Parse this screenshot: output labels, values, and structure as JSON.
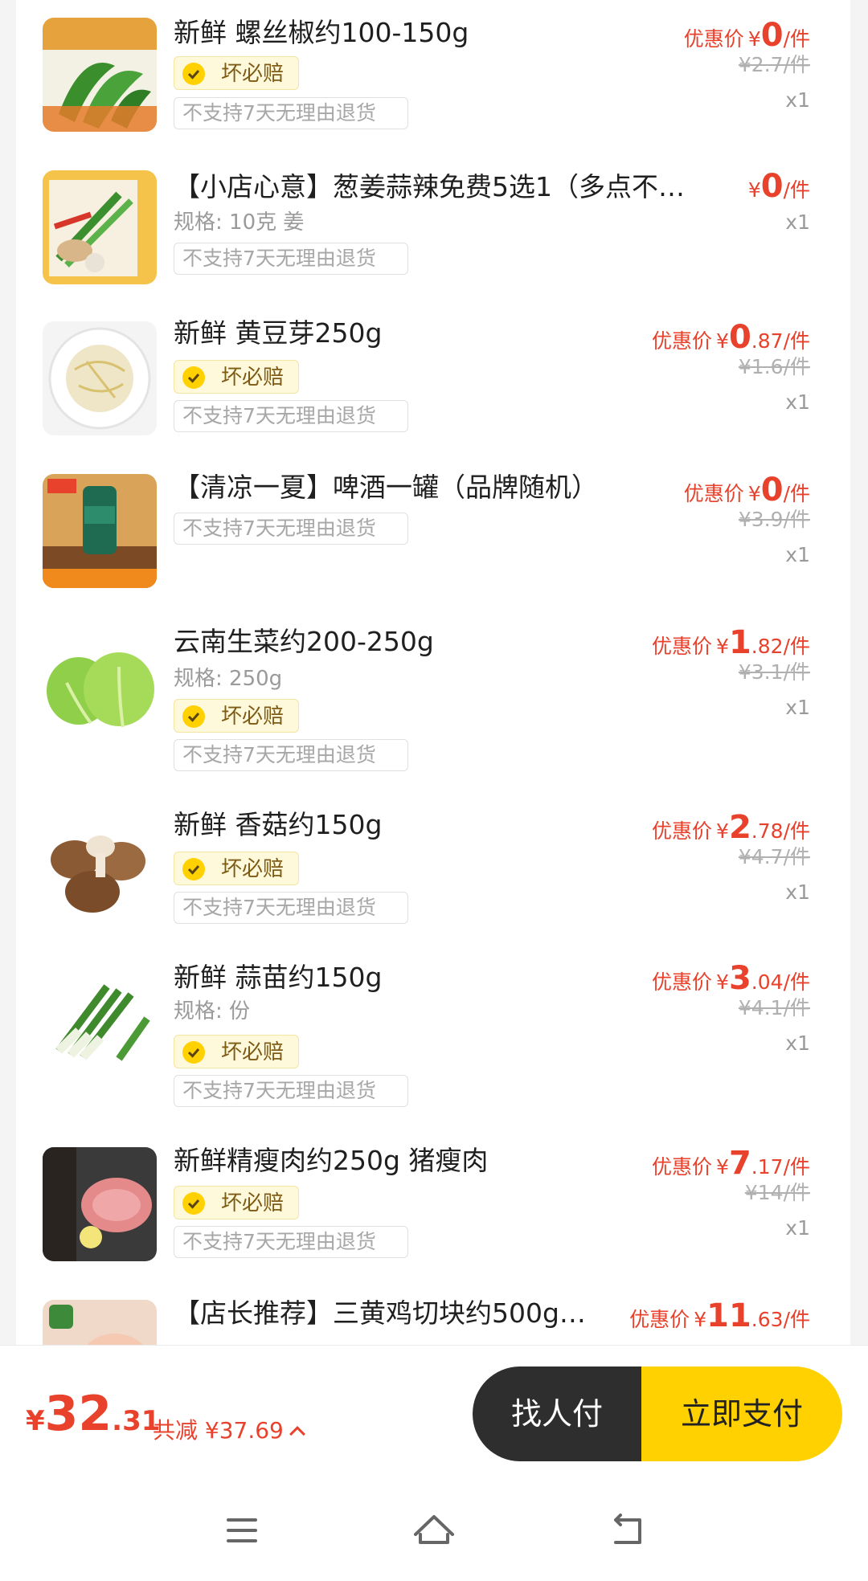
{
  "items": [
    {
      "title": "新鲜 螺丝椒约100-150g",
      "spec": "",
      "badge": "坏必赔",
      "no_return": "不支持7天无理由退货",
      "price_label": "优惠价",
      "currency": "¥",
      "price_int": "0",
      "price_dec": "",
      "unit": "/件",
      "original_price": "¥2.7/件",
      "qty": "x1",
      "image": "green-peppers"
    },
    {
      "title": "【小店心意】葱姜蒜辣免费5选1（多点不…",
      "spec": "规格: 10克 姜",
      "badge": "",
      "no_return": "不支持7天无理由退货",
      "price_label": "",
      "currency": "¥",
      "price_int": "0",
      "price_dec": "",
      "unit": "/件",
      "original_price": "",
      "qty": "x1",
      "image": "scallion-ginger-garlic"
    },
    {
      "title": "新鲜 黄豆芽250g",
      "spec": "",
      "badge": "坏必赔",
      "no_return": "不支持7天无理由退货",
      "price_label": "优惠价",
      "currency": "¥",
      "price_int": "0",
      "price_dec": ".87",
      "unit": "/件",
      "original_price": "¥1.6/件",
      "qty": "x1",
      "image": "bean-sprouts"
    },
    {
      "title": "【清凉一夏】啤酒一罐（品牌随机）",
      "spec": "",
      "badge": "",
      "no_return": "不支持7天无理由退货",
      "price_label": "优惠价",
      "currency": "¥",
      "price_int": "0",
      "price_dec": "",
      "unit": "/件",
      "original_price": "¥3.9/件",
      "qty": "x1",
      "image": "beer-can"
    },
    {
      "title": "云南生菜约200-250g",
      "spec": "规格: 250g",
      "badge": "坏必赔",
      "no_return": "不支持7天无理由退货",
      "price_label": "优惠价",
      "currency": "¥",
      "price_int": "1",
      "price_dec": ".82",
      "unit": "/件",
      "original_price": "¥3.1/件",
      "qty": "x1",
      "image": "lettuce"
    },
    {
      "title": "新鲜 香菇约150g",
      "spec": "",
      "badge": "坏必赔",
      "no_return": "不支持7天无理由退货",
      "price_label": "优惠价",
      "currency": "¥",
      "price_int": "2",
      "price_dec": ".78",
      "unit": "/件",
      "original_price": "¥4.7/件",
      "qty": "x1",
      "image": "shiitake"
    },
    {
      "title": "新鲜 蒜苗约150g",
      "spec": "规格: 份",
      "badge": "坏必赔",
      "no_return": "不支持7天无理由退货",
      "price_label": "优惠价",
      "currency": "¥",
      "price_int": "3",
      "price_dec": ".04",
      "unit": "/件",
      "original_price": "¥4.1/件",
      "qty": "x1",
      "image": "garlic-sprouts"
    },
    {
      "title": "新鲜精瘦肉约250g 猪瘦肉",
      "spec": "",
      "badge": "坏必赔",
      "no_return": "不支持7天无理由退货",
      "price_label": "优惠价",
      "currency": "¥",
      "price_int": "7",
      "price_dec": ".17",
      "unit": "/件",
      "original_price": "¥14/件",
      "qty": "x1",
      "image": "lean-pork"
    },
    {
      "title": "【店长推荐】三黄鸡切块约500g…",
      "spec": "",
      "badge": "",
      "no_return": "",
      "price_label": "优惠价",
      "currency": "¥",
      "price_int": "11",
      "price_dec": ".63",
      "unit": "/件",
      "original_price": "",
      "qty": "",
      "image": "chicken-pieces"
    }
  ],
  "footer": {
    "currency": "¥",
    "total_int": "32",
    "total_dec": ".31",
    "saving_text": "共减 ¥37.69",
    "find_payer_label": "找人付",
    "pay_now_label": "立即支付"
  },
  "nav": {
    "menu_icon": "menu-icon",
    "home_icon": "home-icon",
    "back_icon": "back-icon"
  },
  "colors": {
    "accent_red": "#e8412c",
    "pay_yellow": "#ffd100",
    "dark_button": "#2e2e2e"
  }
}
